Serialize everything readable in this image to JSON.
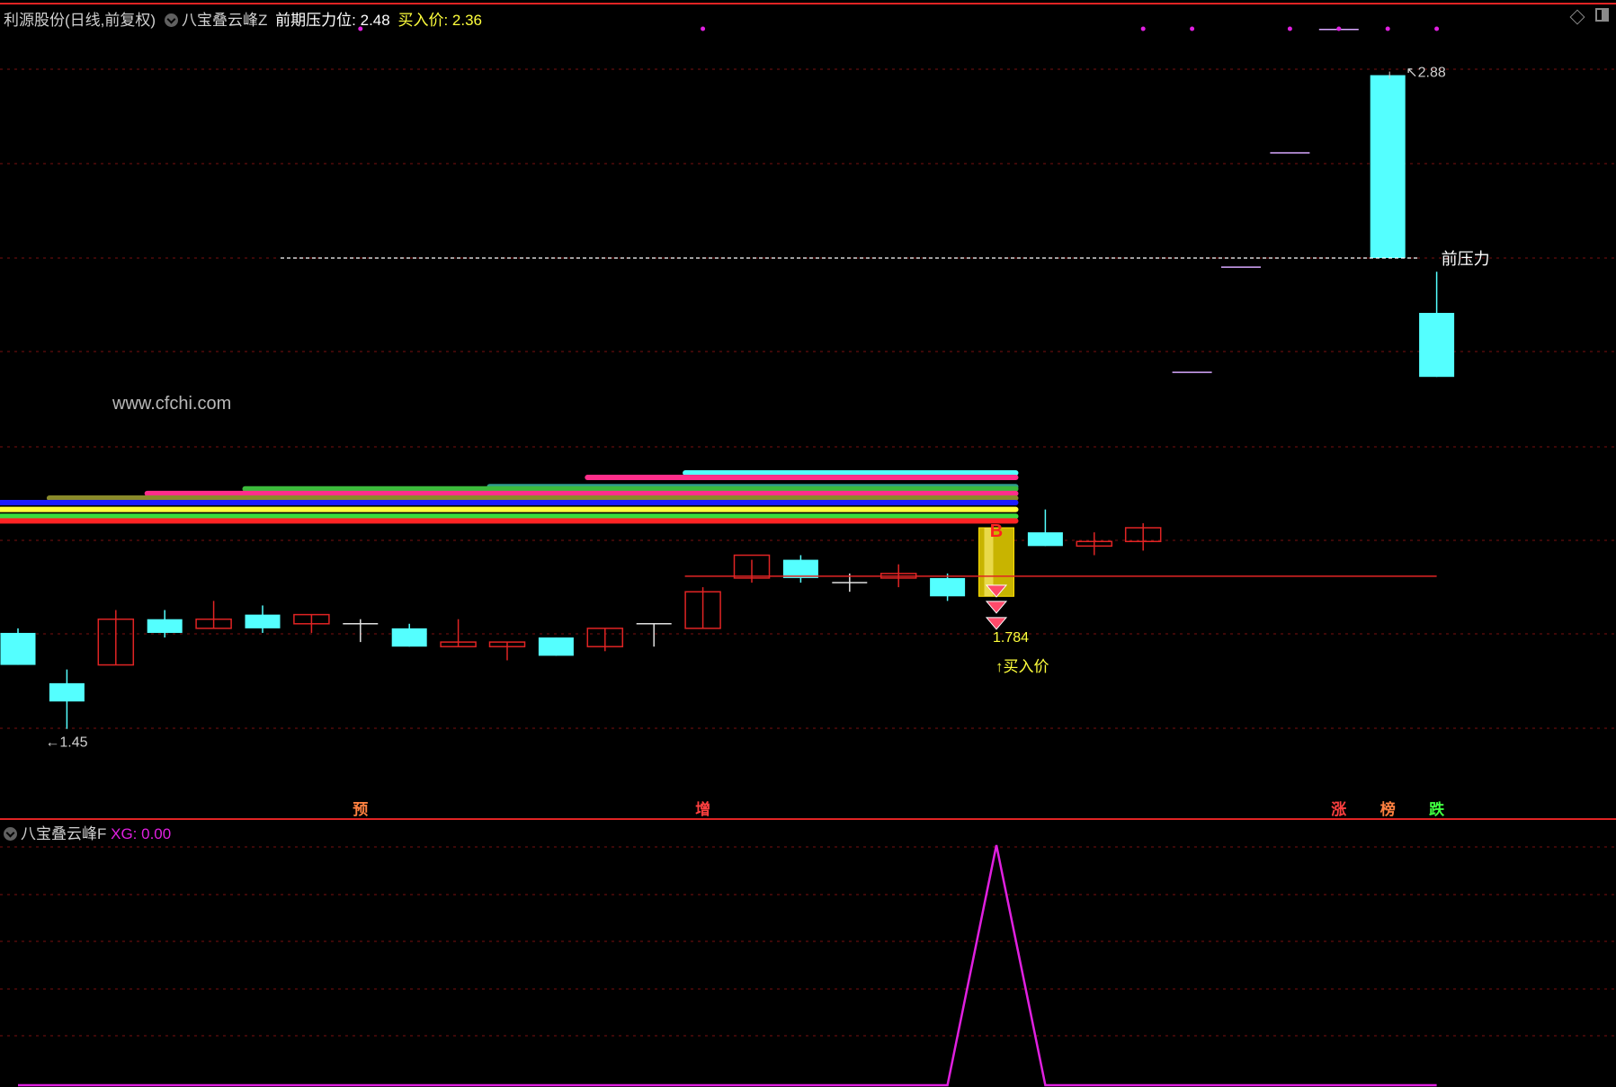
{
  "header": {
    "symbol_title": "利源股份(日线,前复权)",
    "indicator_main": "八宝叠云峰Z",
    "pressure_label": "前期压力位: 2.48",
    "buy_label": "买入价: 2.36"
  },
  "sub_header": {
    "indicator_sub": "八宝叠云峰F",
    "xg_label": "XG: 0.00"
  },
  "watermark": "www.cfchi.com",
  "annotations": {
    "low_price": "←1.45",
    "high_price": "2.88",
    "pressure_text": "前压力",
    "buy_value": "1.784",
    "buy_text": "↑买入价",
    "b_marker": "B",
    "tag_yu": "预",
    "tag_zeng": "增",
    "tag_zhang": "涨",
    "tag_bang": "榜",
    "tag_die": "跌"
  },
  "colors": {
    "up": "#e02424",
    "down": "#54ffff",
    "magenta": "#e020e0",
    "gold": "#e8d000",
    "grid": "#7a1010"
  },
  "chart_data": [
    {
      "type": "candlestick",
      "bar_count": 30,
      "ylim": [
        1.3,
        2.95
      ],
      "candles": [
        {
          "o": 1.66,
          "h": 1.67,
          "l": 1.59,
          "c": 1.59
        },
        {
          "o": 1.55,
          "h": 1.58,
          "l": 1.45,
          "c": 1.51
        },
        {
          "o": 1.59,
          "h": 1.71,
          "l": 1.59,
          "c": 1.69
        },
        {
          "o": 1.69,
          "h": 1.71,
          "l": 1.65,
          "c": 1.66
        },
        {
          "o": 1.67,
          "h": 1.73,
          "l": 1.67,
          "c": 1.69
        },
        {
          "o": 1.7,
          "h": 1.72,
          "l": 1.66,
          "c": 1.67
        },
        {
          "o": 1.68,
          "h": 1.7,
          "l": 1.66,
          "c": 1.7
        },
        {
          "o": 1.68,
          "h": 1.69,
          "l": 1.64,
          "c": 1.68
        },
        {
          "o": 1.67,
          "h": 1.68,
          "l": 1.63,
          "c": 1.63
        },
        {
          "o": 1.63,
          "h": 1.69,
          "l": 1.63,
          "c": 1.64
        },
        {
          "o": 1.63,
          "h": 1.64,
          "l": 1.6,
          "c": 1.64
        },
        {
          "o": 1.65,
          "h": 1.65,
          "l": 1.61,
          "c": 1.61
        },
        {
          "o": 1.63,
          "h": 1.67,
          "l": 1.62,
          "c": 1.67
        },
        {
          "o": 1.68,
          "h": 1.68,
          "l": 1.63,
          "c": 1.68
        },
        {
          "o": 1.67,
          "h": 1.76,
          "l": 1.67,
          "c": 1.75
        },
        {
          "o": 1.78,
          "h": 1.82,
          "l": 1.77,
          "c": 1.83
        },
        {
          "o": 1.82,
          "h": 1.83,
          "l": 1.77,
          "c": 1.78
        },
        {
          "o": 1.77,
          "h": 1.79,
          "l": 1.75,
          "c": 1.77
        },
        {
          "o": 1.78,
          "h": 1.81,
          "l": 1.76,
          "c": 1.79
        },
        {
          "o": 1.78,
          "h": 1.79,
          "l": 1.73,
          "c": 1.74
        },
        {
          "o": 1.74,
          "h": 1.89,
          "l": 1.74,
          "c": 1.89
        },
        {
          "o": 1.88,
          "h": 1.93,
          "l": 1.85,
          "c": 1.85
        },
        {
          "o": 1.85,
          "h": 1.88,
          "l": 1.83,
          "c": 1.86
        },
        {
          "o": 1.86,
          "h": 1.9,
          "l": 1.84,
          "c": 1.89
        },
        {
          "o": null,
          "h": null,
          "l": null,
          "c": null
        },
        {
          "o": null,
          "h": null,
          "l": null,
          "c": null
        },
        {
          "o": null,
          "h": null,
          "l": null,
          "c": null
        },
        {
          "o": null,
          "h": null,
          "l": null,
          "c": null
        },
        {
          "o": 2.88,
          "h": 2.88,
          "l": 2.48,
          "c": 2.48
        },
        {
          "o": 2.36,
          "h": 2.45,
          "l": 2.22,
          "c": 2.22
        }
      ],
      "dashes": [
        {
          "bar": 24,
          "y": 2.23
        },
        {
          "bar": 25,
          "y": 2.46
        },
        {
          "bar": 26,
          "y": 2.71
        },
        {
          "bar": 27,
          "y": 2.98
        }
      ],
      "buy_bar": 20,
      "buy_price": 1.784,
      "pressure_price": 2.48,
      "support_price": 1.784,
      "ribbons": [
        {
          "start_bar": 14,
          "y": 2.01,
          "color": "#54ffff"
        },
        {
          "start_bar": 12,
          "y": 2.0,
          "color": "#ff2e8a"
        },
        {
          "start_bar": 10,
          "y": 1.98,
          "color": "#2f9c8c"
        },
        {
          "start_bar": 5,
          "y": 1.975,
          "color": "#3cbb3c"
        },
        {
          "start_bar": 3,
          "y": 1.965,
          "color": "#ff2e8a"
        },
        {
          "start_bar": 1,
          "y": 1.955,
          "color": "#8a8a2a"
        },
        {
          "start_bar": 0,
          "y": 1.945,
          "color": "#1b1bff"
        },
        {
          "start_bar": 0,
          "y": 1.93,
          "color": "#ffff3c"
        },
        {
          "start_bar": 0,
          "y": 1.915,
          "color": "#3cdd3c"
        },
        {
          "start_bar": 0,
          "y": 1.905,
          "color": "#ff2424"
        }
      ],
      "top_markers": [
        7,
        14,
        23,
        24,
        26,
        27,
        28,
        29
      ]
    },
    {
      "type": "line",
      "series_name": "XG",
      "ylim": [
        0,
        1
      ],
      "x": [
        0,
        1,
        2,
        3,
        4,
        5,
        6,
        7,
        8,
        9,
        10,
        11,
        12,
        13,
        14,
        15,
        16,
        17,
        18,
        19,
        20,
        21,
        22,
        23,
        24,
        25,
        26,
        27,
        28,
        29
      ],
      "values": [
        0,
        0,
        0,
        0,
        0,
        0,
        0,
        0,
        0,
        0,
        0,
        0,
        0,
        0,
        0,
        0,
        0,
        0,
        0,
        0,
        1,
        0,
        0,
        0,
        0,
        0,
        0,
        0,
        0,
        0
      ]
    }
  ]
}
